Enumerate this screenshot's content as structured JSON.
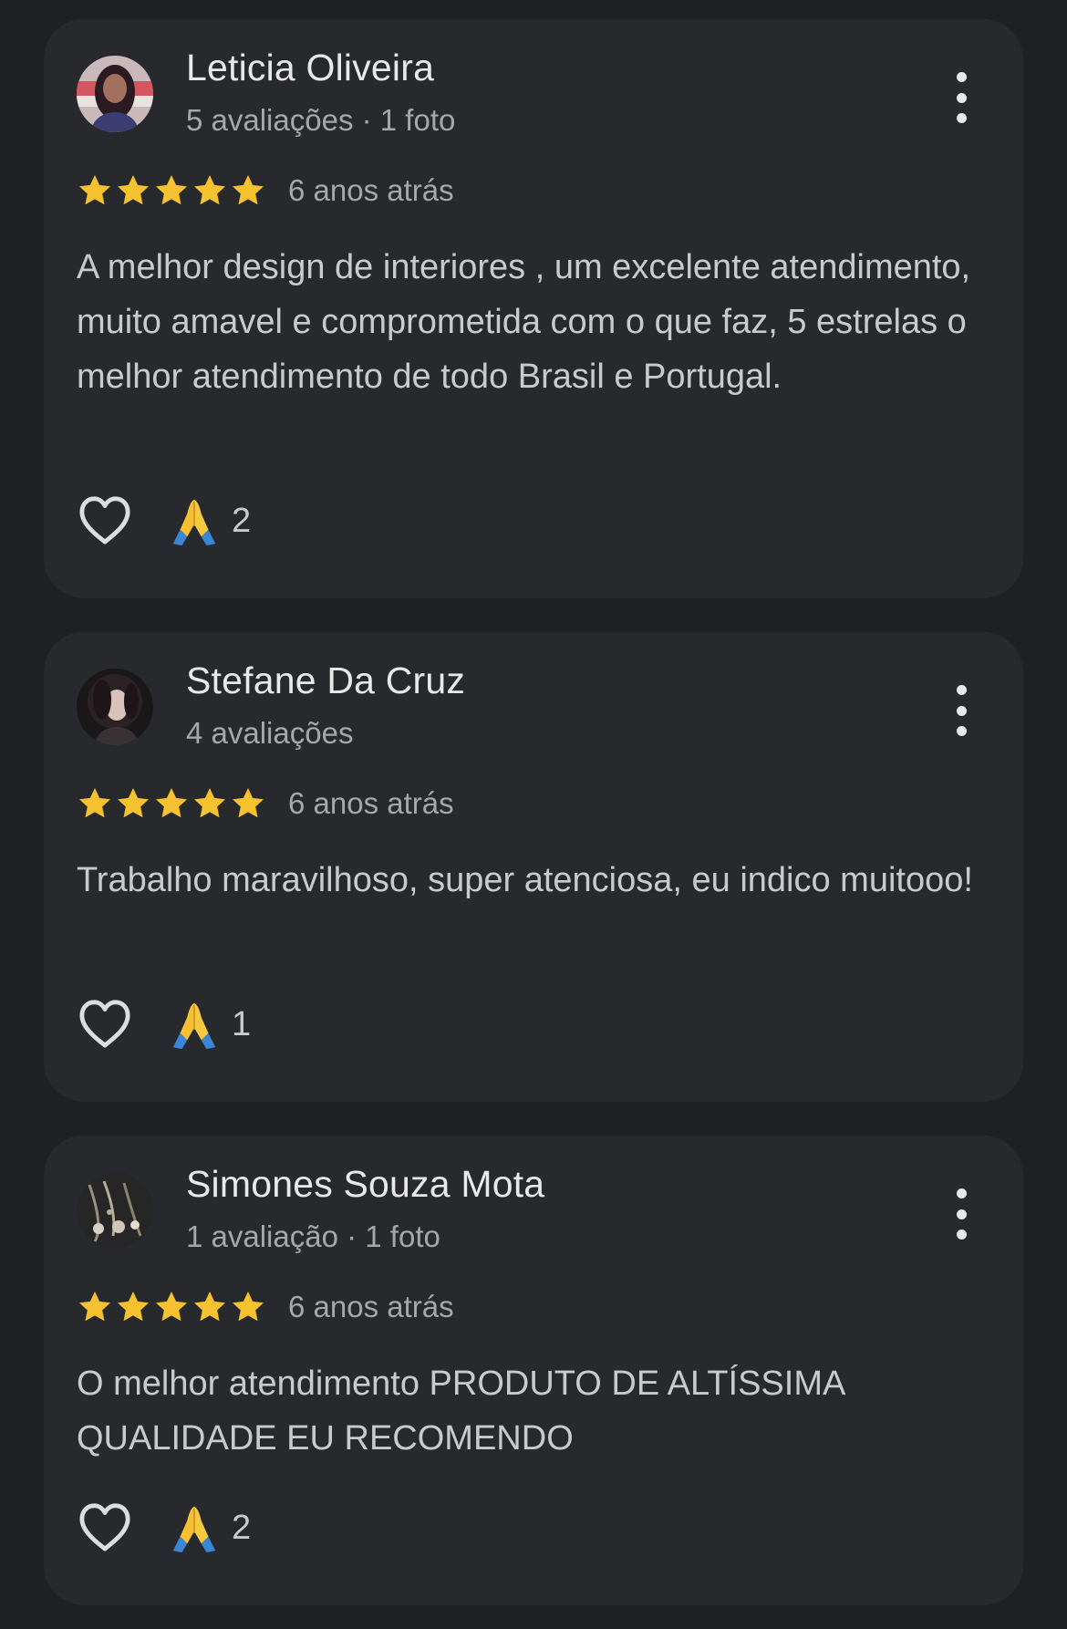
{
  "reviews": [
    {
      "name": "Leticia Oliveira",
      "meta": "5 avaliações · 1 foto",
      "rating": 5,
      "time_ago": "6 anos atrás",
      "text": "A melhor design de interiores , um excelente atendimento, muito amavel e comprometida com o que faz, 5 estrelas o melhor atendimento de todo Brasil e Portugal.",
      "reaction_count": "2"
    },
    {
      "name": "Stefane Da Cruz",
      "meta": "4 avaliações",
      "rating": 5,
      "time_ago": "6 anos atrás",
      "text": "Trabalho maravilhoso, super atenciosa, eu indico muitooo!",
      "reaction_count": "1"
    },
    {
      "name": "Simones Souza Mota",
      "meta": "1 avaliação · 1 foto",
      "rating": 5,
      "time_ago": "6 anos atrás",
      "text": "O melhor atendimento PRODUTO DE ALTÍSSIMA QUALIDADE EU RECOMENDO",
      "reaction_count": "2"
    }
  ],
  "colors": {
    "background": "#1f2023",
    "card": "#28292d",
    "star": "#f6c22f",
    "name_text": "#e9e9ea",
    "secondary_text": "#a5a7ab",
    "body_text": "#c8cacd"
  },
  "icons": {
    "menu": "more-vert-icon",
    "like": "heart-outline-icon",
    "reaction": "folded-hands-emoji-icon",
    "star": "star-filled-icon"
  }
}
